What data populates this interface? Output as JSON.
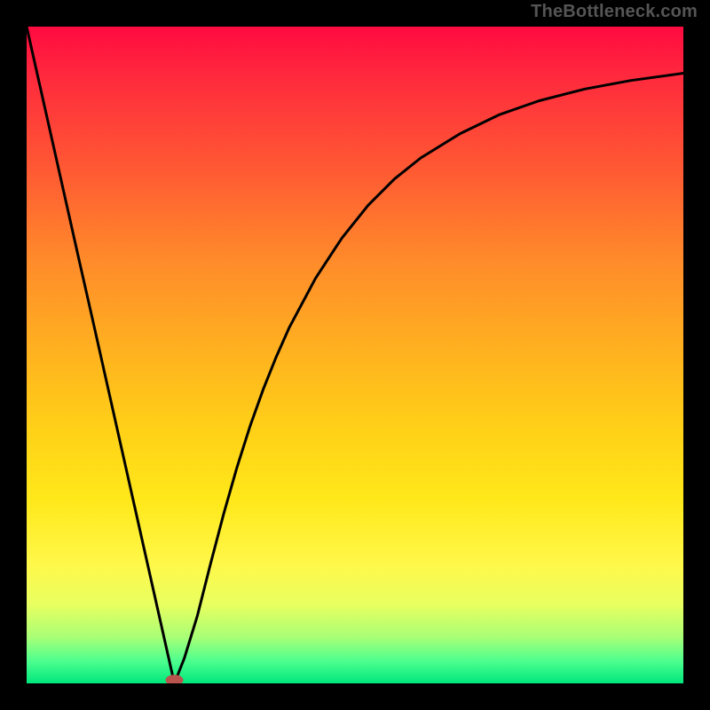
{
  "watermark": "TheBottleneck.com",
  "chart_data": {
    "type": "line",
    "title": "",
    "xlabel": "",
    "ylabel": "",
    "xlim": [
      0,
      1
    ],
    "ylim": [
      0,
      1
    ],
    "minimum_marker": {
      "x": 0.225,
      "y": 0.005,
      "color": "#b9534e"
    },
    "series": [
      {
        "name": "bottleneck-curve",
        "color": "#000000",
        "x": [
          0.0,
          0.02,
          0.04,
          0.06,
          0.08,
          0.1,
          0.12,
          0.14,
          0.16,
          0.18,
          0.2,
          0.22,
          0.225,
          0.24,
          0.26,
          0.28,
          0.3,
          0.32,
          0.34,
          0.36,
          0.38,
          0.4,
          0.44,
          0.48,
          0.52,
          0.56,
          0.6,
          0.66,
          0.72,
          0.78,
          0.85,
          0.92,
          1.0
        ],
        "y": [
          1.0,
          0.911,
          0.822,
          0.733,
          0.644,
          0.556,
          0.467,
          0.378,
          0.289,
          0.2,
          0.111,
          0.022,
          0.0,
          0.038,
          0.103,
          0.182,
          0.258,
          0.328,
          0.391,
          0.447,
          0.497,
          0.542,
          0.617,
          0.678,
          0.728,
          0.768,
          0.8,
          0.837,
          0.866,
          0.887,
          0.905,
          0.918,
          0.929
        ]
      }
    ]
  }
}
